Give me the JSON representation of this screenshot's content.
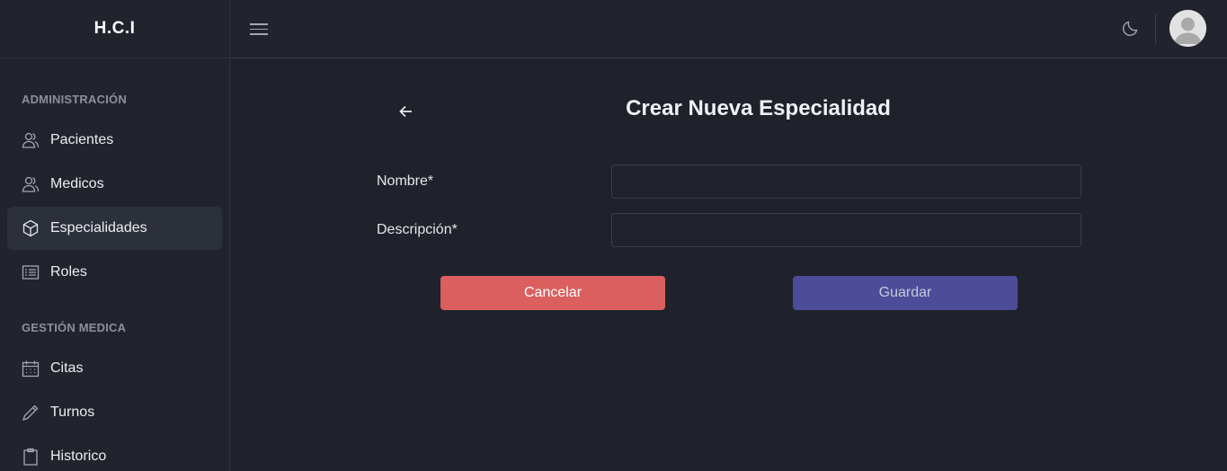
{
  "app": {
    "brand": "H.C.I"
  },
  "sidebar": {
    "sections": [
      {
        "title": "ADMINISTRACIÓN",
        "items": [
          {
            "label": "Pacientes",
            "icon": "users-icon",
            "active": false
          },
          {
            "label": "Medicos",
            "icon": "users-icon",
            "active": false
          },
          {
            "label": "Especialidades",
            "icon": "cube-icon",
            "active": true
          },
          {
            "label": "Roles",
            "icon": "list-icon",
            "active": false
          }
        ]
      },
      {
        "title": "GESTIÓN MEDICA",
        "items": [
          {
            "label": "Citas",
            "icon": "calendar-icon",
            "active": false
          },
          {
            "label": "Turnos",
            "icon": "pencil-icon",
            "active": false
          },
          {
            "label": "Historico",
            "icon": "clipboard-icon",
            "active": false
          }
        ]
      }
    ]
  },
  "topbar": {
    "theme_icon": "moon-icon",
    "menu_icon": "hamburger-icon",
    "avatar_icon": "user-avatar-icon"
  },
  "form": {
    "title": "Crear Nueva Especialidad",
    "fields": [
      {
        "label": "Nombre*",
        "value": "",
        "placeholder": ""
      },
      {
        "label": "Descripción*",
        "value": "",
        "placeholder": ""
      }
    ],
    "cancel_label": "Cancelar",
    "save_label": "Guardar"
  },
  "colors": {
    "background": "#1f222a",
    "sidebar": "#21242c",
    "active_item": "#2c303a",
    "cancel": "#dc5f5f",
    "save": "#4c4c99"
  }
}
